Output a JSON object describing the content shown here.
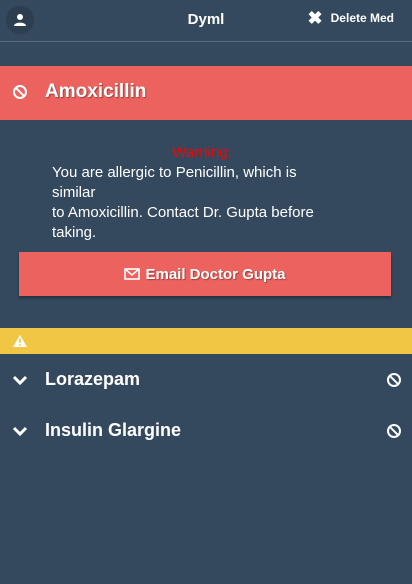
{
  "header": {
    "title": "Dyml",
    "delete_label": "Delete Med",
    "avatar_icon": "user-icon",
    "delete_icon": "close-icon"
  },
  "active_med": {
    "name": "Amoxicillin",
    "icon": "ban-icon",
    "color": "#ec625e"
  },
  "warning": {
    "label": "Warning:",
    "text": "You are allergic to Penicillin, which is\nsimilar\nto Amoxicillin. Contact Dr. Gupta before\ntaking.",
    "label_color": "#ff0000"
  },
  "email_button": {
    "label": "Email Doctor Gupta",
    "icon": "envelope-icon"
  },
  "alert_bar": {
    "icon": "warning-icon",
    "color": "#f1c644"
  },
  "med_list": [
    {
      "name": "Lorazepam",
      "expand_icon": "chevron-down-icon",
      "action_icon": "ban-icon"
    },
    {
      "name": "Insulin Glargine",
      "expand_icon": "chevron-down-icon",
      "action_icon": "ban-icon"
    }
  ],
  "colors": {
    "background": "#34495e",
    "accent": "#ec625e",
    "alert": "#f1c644"
  }
}
